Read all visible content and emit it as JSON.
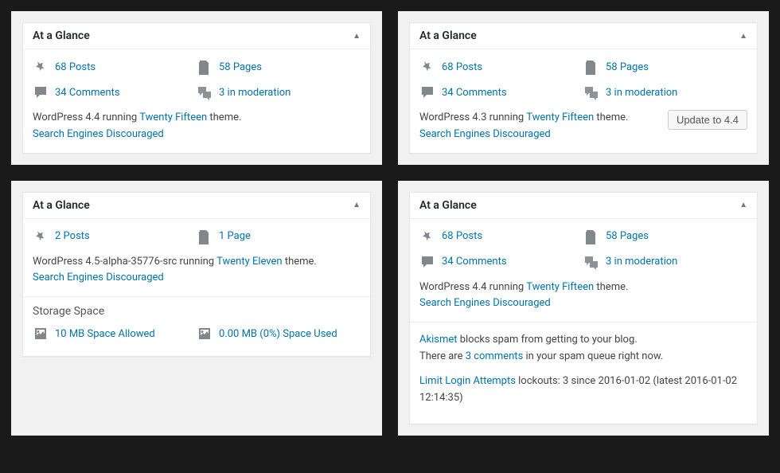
{
  "panels": [
    {
      "title": "At a Glance",
      "stats": [
        {
          "icon": "pin",
          "text": "68 Posts"
        },
        {
          "icon": "page",
          "text": "58 Pages"
        },
        {
          "icon": "comment",
          "text": "34 Comments"
        },
        {
          "icon": "mod",
          "text": "3 in moderation"
        }
      ],
      "version_pre": "WordPress 4.4 running ",
      "theme": "Twenty Fifteen",
      "version_post": " theme.",
      "search_engines": "Search Engines Discouraged"
    },
    {
      "title": "At a Glance",
      "stats": [
        {
          "icon": "pin",
          "text": "68 Posts"
        },
        {
          "icon": "page",
          "text": "58 Pages"
        },
        {
          "icon": "comment",
          "text": "34 Comments"
        },
        {
          "icon": "mod",
          "text": "3 in moderation"
        }
      ],
      "version_pre": "WordPress 4.3 running ",
      "theme": "Twenty Fifteen",
      "version_post": " theme.",
      "search_engines": "Search Engines Discouraged",
      "update_button": "Update to 4.4"
    },
    {
      "title": "At a Glance",
      "stats": [
        {
          "icon": "pin",
          "text": "2 Posts"
        },
        {
          "icon": "page",
          "text": "1 Page"
        }
      ],
      "version_pre": "WordPress 4.5-alpha-35776-src running ",
      "theme": "Twenty Eleven",
      "version_post": " theme.",
      "search_engines": "Search Engines Discouraged",
      "storage_title": "Storage Space",
      "storage": [
        {
          "icon": "media",
          "text": "10 MB Space Allowed"
        },
        {
          "icon": "media",
          "text": "0.00 MB (0%) Space Used"
        }
      ]
    },
    {
      "title": "At a Glance",
      "stats": [
        {
          "icon": "pin",
          "text": "68 Posts"
        },
        {
          "icon": "page",
          "text": "58 Pages"
        },
        {
          "icon": "comment",
          "text": "34 Comments"
        },
        {
          "icon": "mod",
          "text": "3 in moderation"
        }
      ],
      "version_pre": "WordPress 4.4 running ",
      "theme": "Twenty Fifteen",
      "version_post": " theme.",
      "search_engines": "Search Engines Discouraged",
      "akismet_link": "Akismet",
      "akismet_text": " blocks spam from getting to your blog.",
      "spam_pre": "There are ",
      "spam_link": "3 comments",
      "spam_post": " in your spam queue right now.",
      "lla_link": "Limit Login Attempts",
      "lla_text": " lockouts: 3 since 2016-01-02 (latest 2016-01-02 12:14:35)"
    }
  ]
}
